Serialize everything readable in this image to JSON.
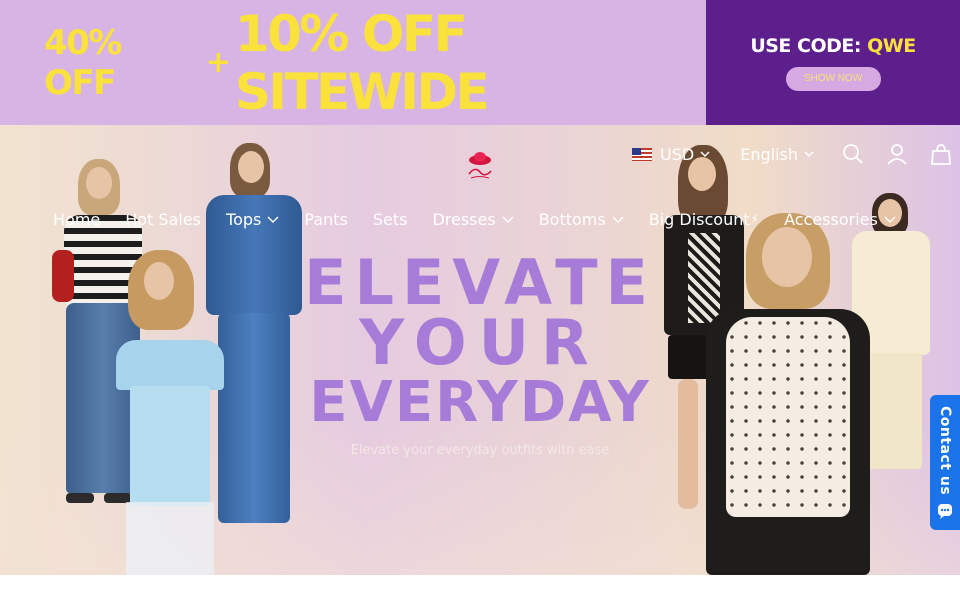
{
  "promo": {
    "small_offer": "40% OFF",
    "plus": "+",
    "big_offer": "10% OFF SITEWIDE",
    "code_prefix": "USE CODE:",
    "code_value": "QWE",
    "shop_button": "SHOW NOW"
  },
  "header": {
    "currency": "USD",
    "language": "English",
    "icons": [
      "search-icon",
      "account-icon",
      "cart-icon"
    ]
  },
  "nav": {
    "items": [
      {
        "label": "Home",
        "dropdown": false
      },
      {
        "label": "Hot Sales",
        "dropdown": false
      },
      {
        "label": "Tops",
        "dropdown": true
      },
      {
        "label": "Pants",
        "dropdown": false
      },
      {
        "label": "Sets",
        "dropdown": false
      },
      {
        "label": "Dresses",
        "dropdown": true
      },
      {
        "label": "Bottoms",
        "dropdown": true
      },
      {
        "label": "Big Discount",
        "dropdown": false
      },
      {
        "label": "Accessories",
        "dropdown": true
      }
    ],
    "discount_symbol": "⚡"
  },
  "hero": {
    "line1": "ELEVATE",
    "line2": "YOUR",
    "line3": "EVERYDAY",
    "subtitle": "Elevate your everyday outfits with ease"
  },
  "contact": {
    "label": "Contact us"
  },
  "colors": {
    "promo_bg": "#d7b4e4",
    "promo_text": "#fae13b",
    "code_bg": "#5d1f8c",
    "headline": "#a77cd9",
    "contact_bg": "#1a73e8"
  }
}
